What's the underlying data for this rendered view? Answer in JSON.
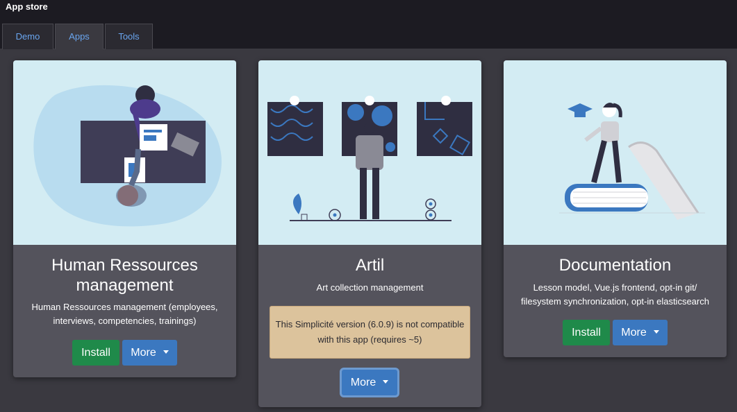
{
  "header": {
    "title": "App store"
  },
  "tabs": [
    {
      "label": "Demo"
    },
    {
      "label": "Apps"
    },
    {
      "label": "Tools"
    }
  ],
  "active_tab": "Apps",
  "colors": {
    "accent": "#3b78c0",
    "install": "#1f8a4a",
    "card_bg": "#54535c",
    "illustration_bg": "#d3ecf3",
    "warning_bg": "#dcc39c"
  },
  "cards": [
    {
      "title": "Human Ressources management",
      "description": "Human Ressources management (employees, interviews, competencies, trainings)",
      "install_label": "Install",
      "more_label": "More"
    },
    {
      "title": "Artil",
      "description": "Art collection management",
      "warning": "This Simplicité version (6.0.9) is not compatible with this app (requires ~5)",
      "more_label": "More"
    },
    {
      "title": "Documentation",
      "description": "Lesson model, Vue.js frontend, opt-in git/ filesystem synchronization, opt-in elasticsearch",
      "install_label": "Install",
      "more_label": "More"
    }
  ]
}
